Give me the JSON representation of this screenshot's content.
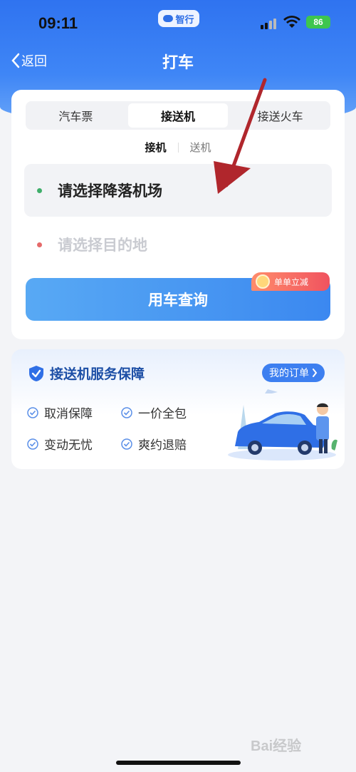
{
  "status_bar": {
    "time": "09:11",
    "brand": "智行",
    "battery": "86"
  },
  "nav": {
    "back_label": "返回",
    "title": "打车"
  },
  "tabs": [
    {
      "label": "汽车票",
      "active": false
    },
    {
      "label": "接送机",
      "active": true
    },
    {
      "label": "接送火车",
      "active": false
    }
  ],
  "subtabs": [
    {
      "label": "接机",
      "active": true
    },
    {
      "label": "送机",
      "active": false
    }
  ],
  "fields": {
    "from": {
      "placeholder": "请选择降落机场",
      "dot_color": "#3fae6a"
    },
    "to": {
      "placeholder": "请选择目的地",
      "dot_color": "#e56a6a"
    }
  },
  "query_button": "用车查询",
  "promo_badge": "单单立减",
  "guarantee": {
    "title": "接送机服务保障",
    "my_orders": "我的订单",
    "items": [
      "取消保障",
      "一价全包",
      "变动无忧",
      "爽约退赔"
    ]
  },
  "watermark": "Bai经验",
  "colors": {
    "primary": "#3d7ff0",
    "header": "#2f73f0",
    "annotation_arrow": "#b0262c"
  }
}
